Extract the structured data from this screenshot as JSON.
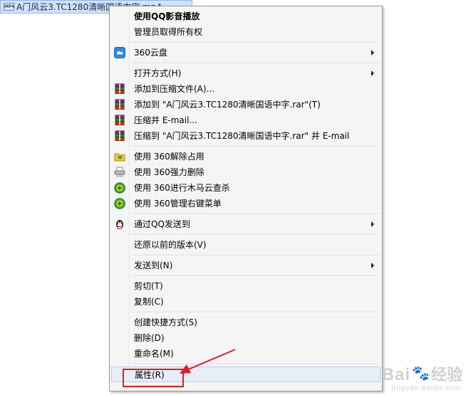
{
  "file": {
    "name": "A门风云3.TC1280清晰国语中字.mp4",
    "icon_label": "MP4",
    "icon": "video-file-icon"
  },
  "menu": {
    "groups": [
      [
        {
          "label": "使用QQ影音播放",
          "bold": true,
          "icon": ""
        },
        {
          "label": "管理员取得所有权",
          "icon": ""
        }
      ],
      [
        {
          "label": "360云盘",
          "icon": "cloud-disk-icon",
          "submenu": true
        }
      ],
      [
        {
          "label": "打开方式(H)",
          "icon": "",
          "submenu": true
        },
        {
          "label": "添加到压缩文件(A)...",
          "icon": "winrar-icon"
        },
        {
          "label": "添加到 \"A门风云3.TC1280清晰国语中字.rar\"(T)",
          "icon": "winrar-icon"
        },
        {
          "label": "压缩并 E-mail...",
          "icon": "winrar-icon"
        },
        {
          "label": "压缩到 \"A门风云3.TC1280清晰国语中字.rar\" 并 E-mail",
          "icon": "winrar-icon"
        }
      ],
      [
        {
          "label": "使用 360解除占用",
          "icon": "unlock-folder-icon"
        },
        {
          "label": "使用 360强力删除",
          "icon": "shredder-icon"
        },
        {
          "label": "使用 360进行木马云查杀",
          "icon": "360-safe-icon"
        },
        {
          "label": "使用 360管理右键菜单",
          "icon": "360-safe-icon"
        }
      ],
      [
        {
          "label": "通过QQ发送到",
          "icon": "qq-penguin-icon",
          "submenu": true
        }
      ],
      [
        {
          "label": "还原以前的版本(V)",
          "icon": ""
        }
      ],
      [
        {
          "label": "发送到(N)",
          "icon": "",
          "submenu": true
        }
      ],
      [
        {
          "label": "剪切(T)",
          "icon": ""
        },
        {
          "label": "复制(C)",
          "icon": ""
        }
      ],
      [
        {
          "label": "创建快捷方式(S)",
          "icon": ""
        },
        {
          "label": "删除(D)",
          "icon": ""
        },
        {
          "label": "重命名(M)",
          "icon": ""
        }
      ],
      [
        {
          "label": "属性(R)",
          "icon": "",
          "highlighted": true
        }
      ]
    ]
  },
  "annotation": {
    "color": "#e31c1c"
  },
  "watermark": {
    "brand_text_1": "Bai",
    "brand_text_2": "经验",
    "url": "jingyan.baidu.com",
    "icon": "paw-icon"
  }
}
